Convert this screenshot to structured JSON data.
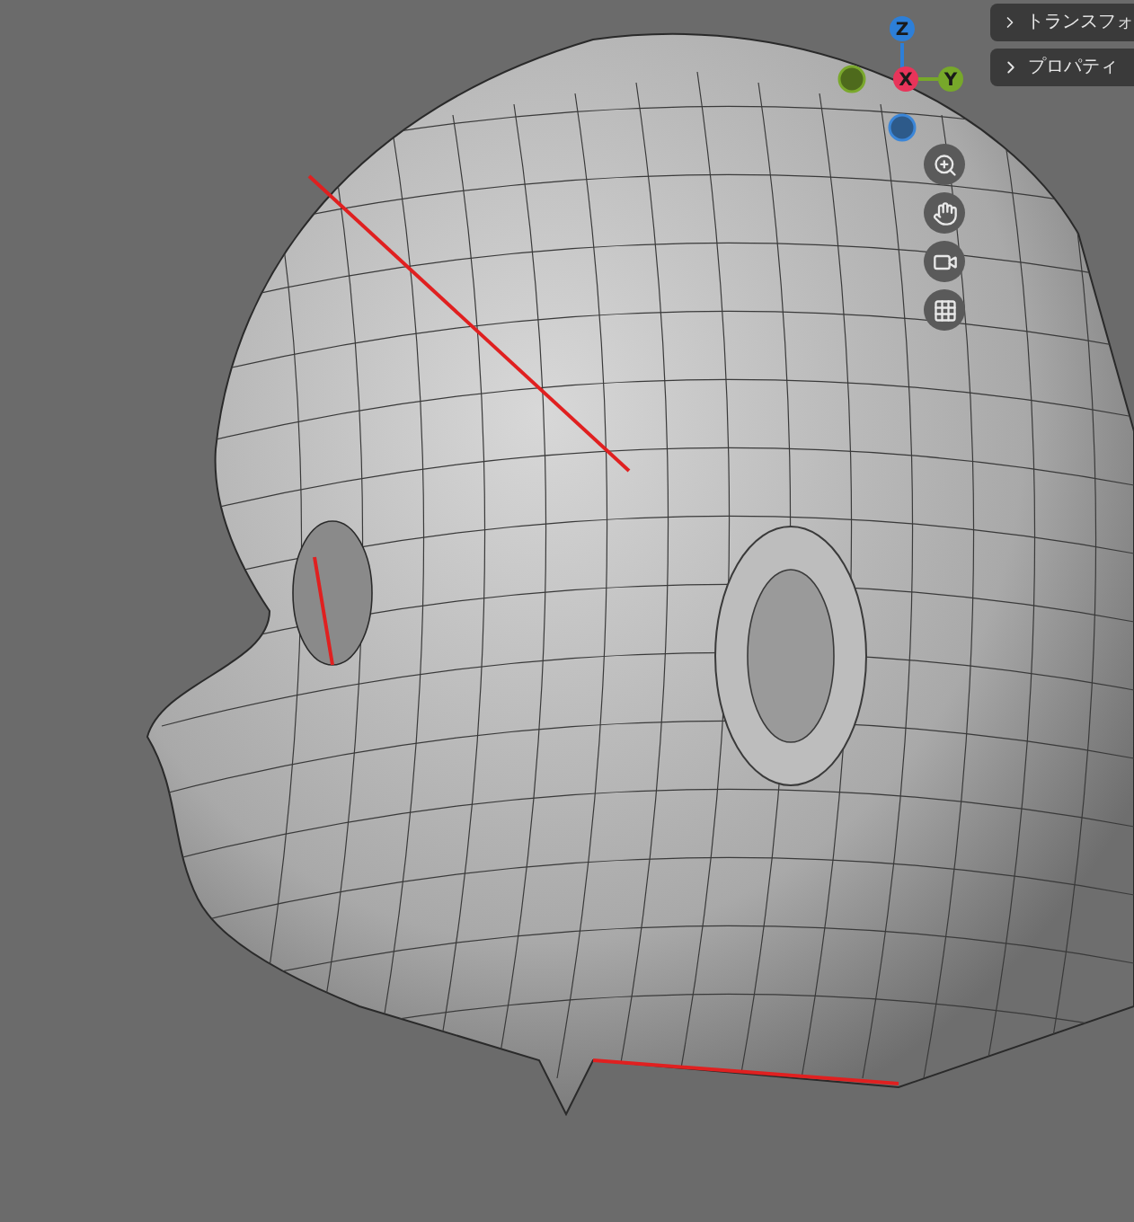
{
  "panels": [
    {
      "label": "トランスフォ",
      "expanded": false
    },
    {
      "label": "プロパティ",
      "expanded": false
    }
  ],
  "gizmo": {
    "axes": [
      {
        "label": "Z",
        "color": "#2d7fd8"
      },
      {
        "label": "X",
        "color": "#e8345a"
      },
      {
        "label": "Y",
        "color": "#77a82a"
      }
    ]
  },
  "nav_tools": [
    {
      "kind": "zoom"
    },
    {
      "kind": "pan"
    },
    {
      "kind": "camera"
    },
    {
      "kind": "grid"
    }
  ]
}
